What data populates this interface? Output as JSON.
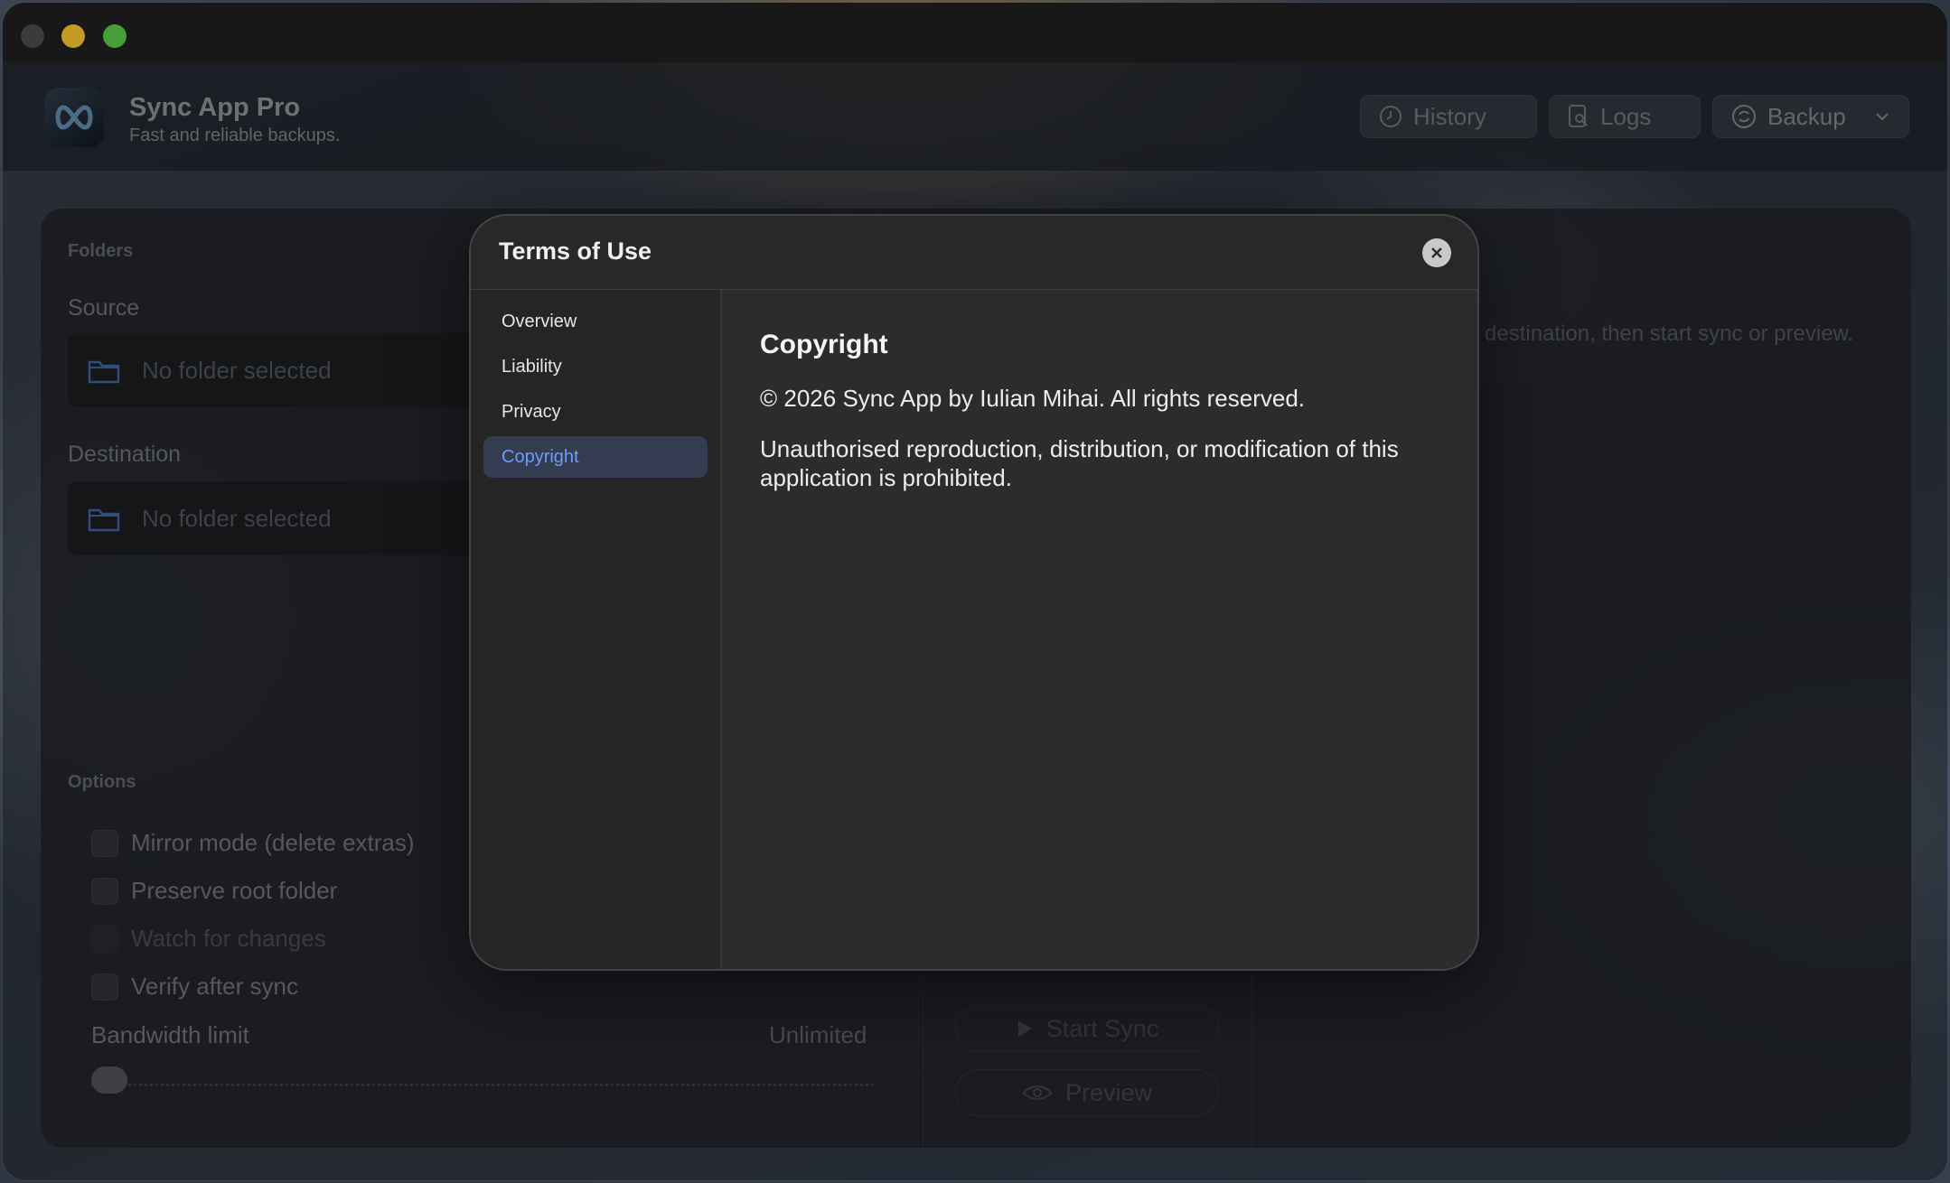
{
  "app": {
    "title": "Sync App Pro",
    "subtitle": "Fast and reliable backups."
  },
  "header": {
    "history_label": "History",
    "logs_label": "Logs",
    "backup_label": "Backup"
  },
  "folders": {
    "section_label": "Folders",
    "source_label": "Source",
    "source_value": "No folder selected",
    "destination_label": "Destination",
    "destination_value": "No folder selected"
  },
  "options": {
    "section_label": "Options",
    "items": [
      {
        "label": "Mirror mode (delete extras)",
        "checked": false,
        "disabled": false
      },
      {
        "label": "Preserve root folder",
        "checked": false,
        "disabled": false
      },
      {
        "label": "Watch for changes",
        "checked": false,
        "disabled": true
      },
      {
        "label": "Verify after sync",
        "checked": false,
        "disabled": false
      }
    ],
    "bandwidth_label": "Bandwidth limit",
    "bandwidth_value": "Unlimited",
    "bandwidth_fraction": 0.0
  },
  "main": {
    "hint": "destination, then start sync or preview.",
    "start_sync_label": "Start Sync",
    "preview_label": "Preview"
  },
  "modal": {
    "title": "Terms of Use",
    "nav": [
      {
        "label": "Overview",
        "active": false
      },
      {
        "label": "Liability",
        "active": false
      },
      {
        "label": "Privacy",
        "active": false
      },
      {
        "label": "Copyright",
        "active": true
      }
    ],
    "content_heading": "Copyright",
    "content_paragraph_1": "© 2026 Sync App by Iulian Mihai. All rights reserved.",
    "content_paragraph_2": "Unauthorised reproduction, distribution, or modification of this application is prohibited."
  },
  "colors": {
    "accent": "#6e9bf5",
    "active_nav_bg": "#343c52",
    "traffic_yellow": "#f5c22e",
    "traffic_green": "#5bc749",
    "folder_icon": "#3f5f9a"
  },
  "icons": {
    "history": "clock-icon",
    "logs": "document-search-icon",
    "backup": "sync-circle-icon",
    "folder": "folder-icon",
    "close": "close-icon",
    "play": "play-icon",
    "preview": "eye-icon"
  }
}
